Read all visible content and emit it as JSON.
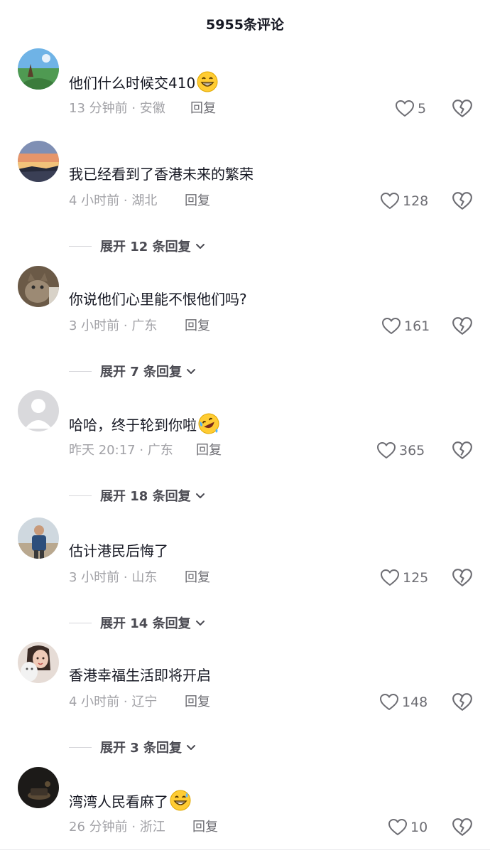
{
  "header": {
    "title": "5955条评论"
  },
  "comments": [
    {
      "text": "他们什么时候交410",
      "emoji": "grin-emoji",
      "meta": "13 分钟前 · 安徽",
      "reply": "回复",
      "likes": "5"
    },
    {
      "text": "我已经看到了香港未来的繁荣",
      "meta": "4 小时前 · 湖北",
      "reply": "回复",
      "likes": "128",
      "expand": "展开 12 条回复"
    },
    {
      "text": "你说他们心里能不恨他们吗?",
      "meta": "3 小时前 · 广东",
      "reply": "回复",
      "likes": "161",
      "expand": "展开 7 条回复"
    },
    {
      "text": "哈哈，终于轮到你啦",
      "emoji": "rofl-emoji",
      "meta": "昨天 20:17 · 广东",
      "reply": "回复",
      "likes": "365",
      "expand": "展开 18 条回复"
    },
    {
      "text": "估计港民后悔了",
      "meta": "3 小时前 · 山东",
      "reply": "回复",
      "likes": "125",
      "expand": "展开 14 条回复"
    },
    {
      "text": "香港幸福生活即将开启",
      "meta": "4 小时前 · 辽宁",
      "reply": "回复",
      "likes": "148",
      "expand": "展开 3 条回复"
    },
    {
      "text": "湾湾人民看麻了",
      "emoji": "sweat-smile-emoji",
      "meta": "26 分钟前 · 浙江",
      "reply": "回复",
      "likes": "10"
    }
  ]
}
